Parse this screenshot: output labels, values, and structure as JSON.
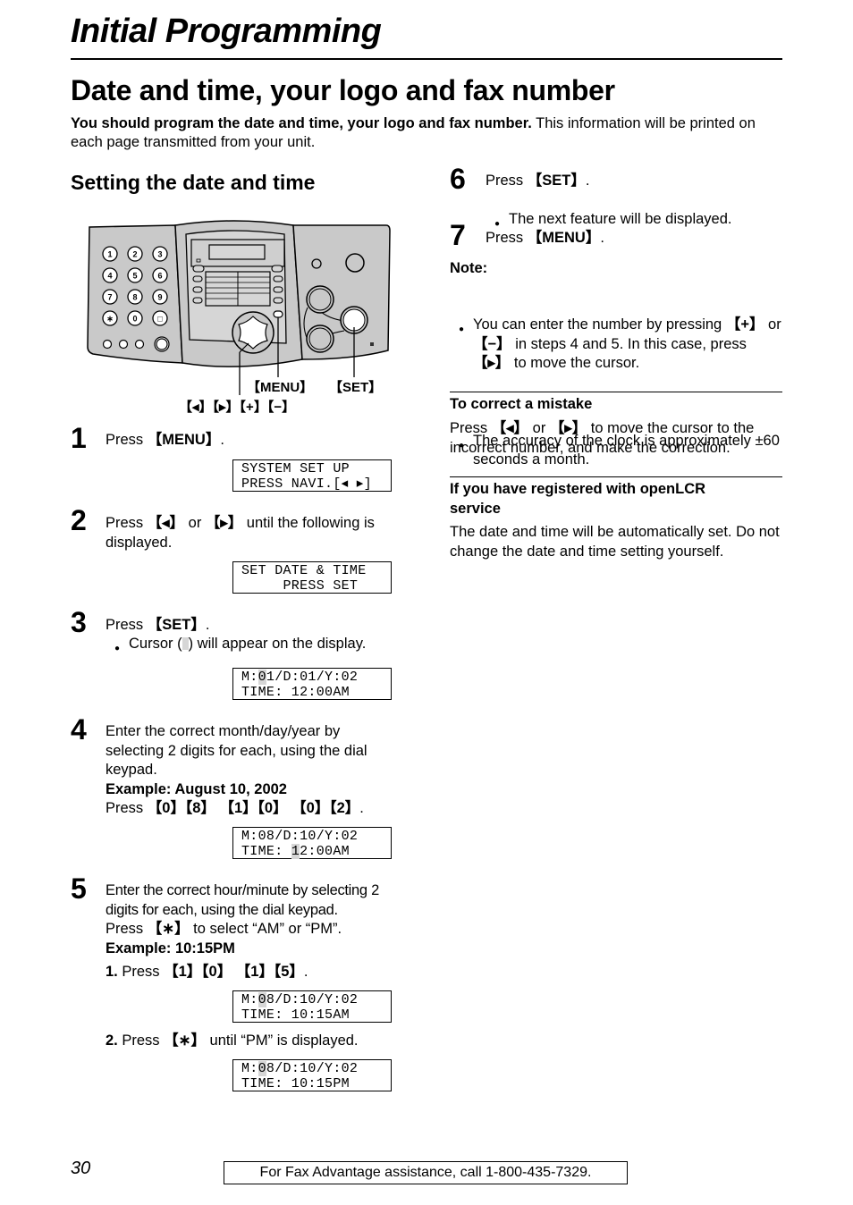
{
  "header": {
    "chapter_title": "Initial Programming",
    "page_title": "Date and time, your logo and fax number",
    "intro_bold": "You should program the date and time, your logo and fax number.",
    "intro_rest": " This information will be printed on each page transmitted from your unit."
  },
  "section": {
    "title": "Setting the date and time"
  },
  "diagram": {
    "keypad_keys": [
      "1",
      "2",
      "3",
      "4",
      "5",
      "6",
      "7",
      "8",
      "9",
      "∗",
      "0",
      "□"
    ],
    "label_menu": "【MENU】",
    "label_set": "【SET】",
    "label_navi": "【◂】【▸】【+】【−】"
  },
  "steps": [
    {
      "num": "1",
      "pre": "Press ",
      "key": "【MENU】",
      "post": ".",
      "lcd": [
        "SYSTEM SET UP",
        "PRESS NAVI.[◂ ▸]"
      ]
    },
    {
      "num": "2",
      "pre": "Press ",
      "key1": "【◂】",
      "mid": " or ",
      "key2": "【▸】",
      "post": " until the following is displayed.",
      "lcd": [
        "SET DATE & TIME",
        "     PRESS SET"
      ]
    },
    {
      "num": "3",
      "pre": "Press ",
      "key": "【SET】",
      "post": ".",
      "bullet_pre": "Cursor (",
      "bullet_post": ") will appear on the display.",
      "lcd_l1_a": "M:",
      "lcd_l1_cur": "0",
      "lcd_l1_b": "1/D:01/Y:02",
      "lcd_l2": "TIME: 12:00AM"
    },
    {
      "num": "4",
      "text": "Enter the correct month/day/year by selecting 2 digits for each, using the dial keypad.",
      "example": "Example: August 10, 2002",
      "press_pre": "Press ",
      "press_keys": "【0】【8】 【1】【0】 【0】【2】",
      "press_post": ".",
      "lcd_l1": "M:08/D:10/Y:02",
      "lcd_l2_a": "TIME: ",
      "lcd_l2_cur": "1",
      "lcd_l2_b": "2:00AM"
    },
    {
      "num": "5",
      "text": "Enter the correct hour/minute by selecting 2 digits for each, using the dial keypad.",
      "press_pre": "Press ",
      "press_key": "【∗】",
      "press_post": " to select “AM” or “PM”.",
      "example": "Example: 10:15PM",
      "sub1_num": "1.",
      "sub1_pre": " Press ",
      "sub1_keys": "【1】【0】 【1】【5】",
      "sub1_post": ".",
      "lcd1_l1_a": "M:",
      "lcd1_l1_cur": "0",
      "lcd1_l1_b": "8/D:10/Y:02",
      "lcd1_l2": "TIME: 10:15AM",
      "sub2_num": "2.",
      "sub2_pre": " Press ",
      "sub2_key": "【∗】",
      "sub2_post": " until “PM” is displayed.",
      "lcd2_l1_a": "M:",
      "lcd2_l1_cur": "0",
      "lcd2_l1_b": "8/D:10/Y:02",
      "lcd2_l2": "TIME: 10:15PM"
    },
    {
      "num": "6",
      "pre": "Press ",
      "key": "【SET】",
      "post": ".",
      "bullet": "The next feature will be displayed."
    },
    {
      "num": "7",
      "pre": "Press ",
      "key": "【MENU】",
      "post": "."
    }
  ],
  "note": {
    "title": "Note:",
    "b1_pre": "You can enter the number by pressing ",
    "b1_key1": "【+】",
    "b1_mid1": " or ",
    "b1_key2": "【−】",
    "b1_mid2": " in steps 4 and 5. In this case, press ",
    "b1_key3": "【▸】",
    "b1_post": " to move the cursor.",
    "b2": "The accuracy of the clock is approximately ±60 seconds a month."
  },
  "correct": {
    "title": "To correct a mistake",
    "pre": "Press ",
    "key1": "【◂】",
    "mid": " or ",
    "key2": "【▸】",
    "post": " to move the cursor to the incorrect number, and make the correction."
  },
  "openlcr": {
    "title": "If you have registered with openLCR service",
    "body": "The date and time will be automatically set. Do not change the date and time setting yourself."
  },
  "footer": {
    "page_number": "30",
    "assistance": "For Fax Advantage assistance, call 1-800-435-7329."
  }
}
